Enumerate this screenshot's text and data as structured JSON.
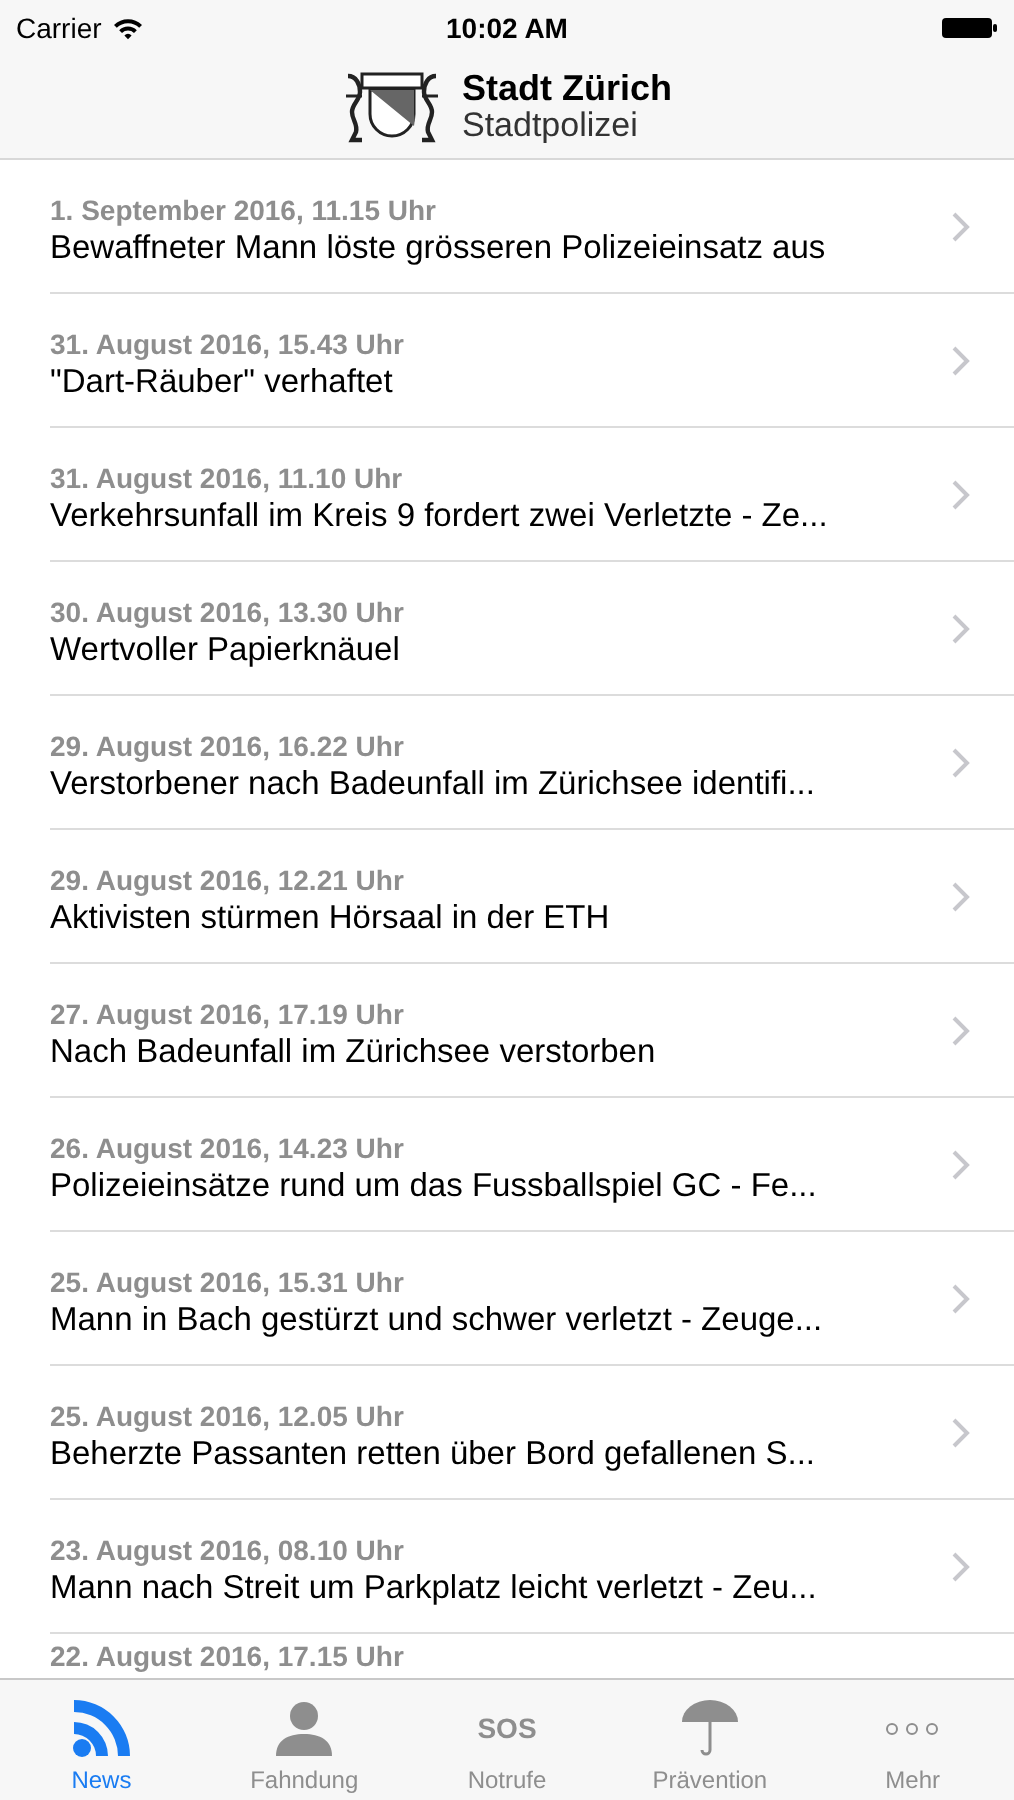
{
  "status_bar": {
    "carrier": "Carrier",
    "time": "10:02 AM"
  },
  "header": {
    "title": "Stadt Zürich",
    "subtitle": "Stadtpolizei"
  },
  "news": [
    {
      "date": "1. September 2016, 11.15 Uhr",
      "headline": "Bewaffneter Mann löste grösseren Polizeieinsatz aus"
    },
    {
      "date": "31. August 2016, 15.43 Uhr",
      "headline": "\"Dart-Räuber\" verhaftet"
    },
    {
      "date": "31. August 2016, 11.10 Uhr",
      "headline": "Verkehrsunfall im Kreis 9 fordert zwei Verletzte - Ze..."
    },
    {
      "date": "30. August 2016, 13.30 Uhr",
      "headline": "Wertvoller Papierknäuel"
    },
    {
      "date": "29. August 2016, 16.22 Uhr",
      "headline": "Verstorbener nach Badeunfall im Zürichsee identifi..."
    },
    {
      "date": "29. August 2016, 12.21 Uhr",
      "headline": "Aktivisten stürmen Hörsaal in der ETH"
    },
    {
      "date": "27. August 2016, 17.19 Uhr",
      "headline": "Nach Badeunfall im Zürichsee verstorben"
    },
    {
      "date": "26. August 2016, 14.23 Uhr",
      "headline": "Polizeieinsätze rund um das Fussballspiel GC - Fe..."
    },
    {
      "date": "25. August 2016, 15.31 Uhr",
      "headline": "Mann in Bach gestürzt und schwer verletzt - Zeuge..."
    },
    {
      "date": "25. August 2016, 12.05 Uhr",
      "headline": "Beherzte Passanten retten über Bord gefallenen S..."
    },
    {
      "date": "23. August 2016, 08.10 Uhr",
      "headline": "Mann nach Streit um Parkplatz leicht verletzt - Zeu..."
    },
    {
      "date": "22. August 2016, 17.15 Uhr"
    }
  ],
  "tabs": [
    {
      "kind": "feed",
      "label": "News",
      "selected": true
    },
    {
      "kind": "person",
      "label": "Fahndung",
      "selected": false
    },
    {
      "kind": "sos",
      "label": "Notrufe",
      "icon_text": "SOS",
      "selected": false
    },
    {
      "kind": "umbrella",
      "label": "Prävention",
      "selected": false
    },
    {
      "kind": "more",
      "label": "Mehr",
      "selected": false
    }
  ]
}
